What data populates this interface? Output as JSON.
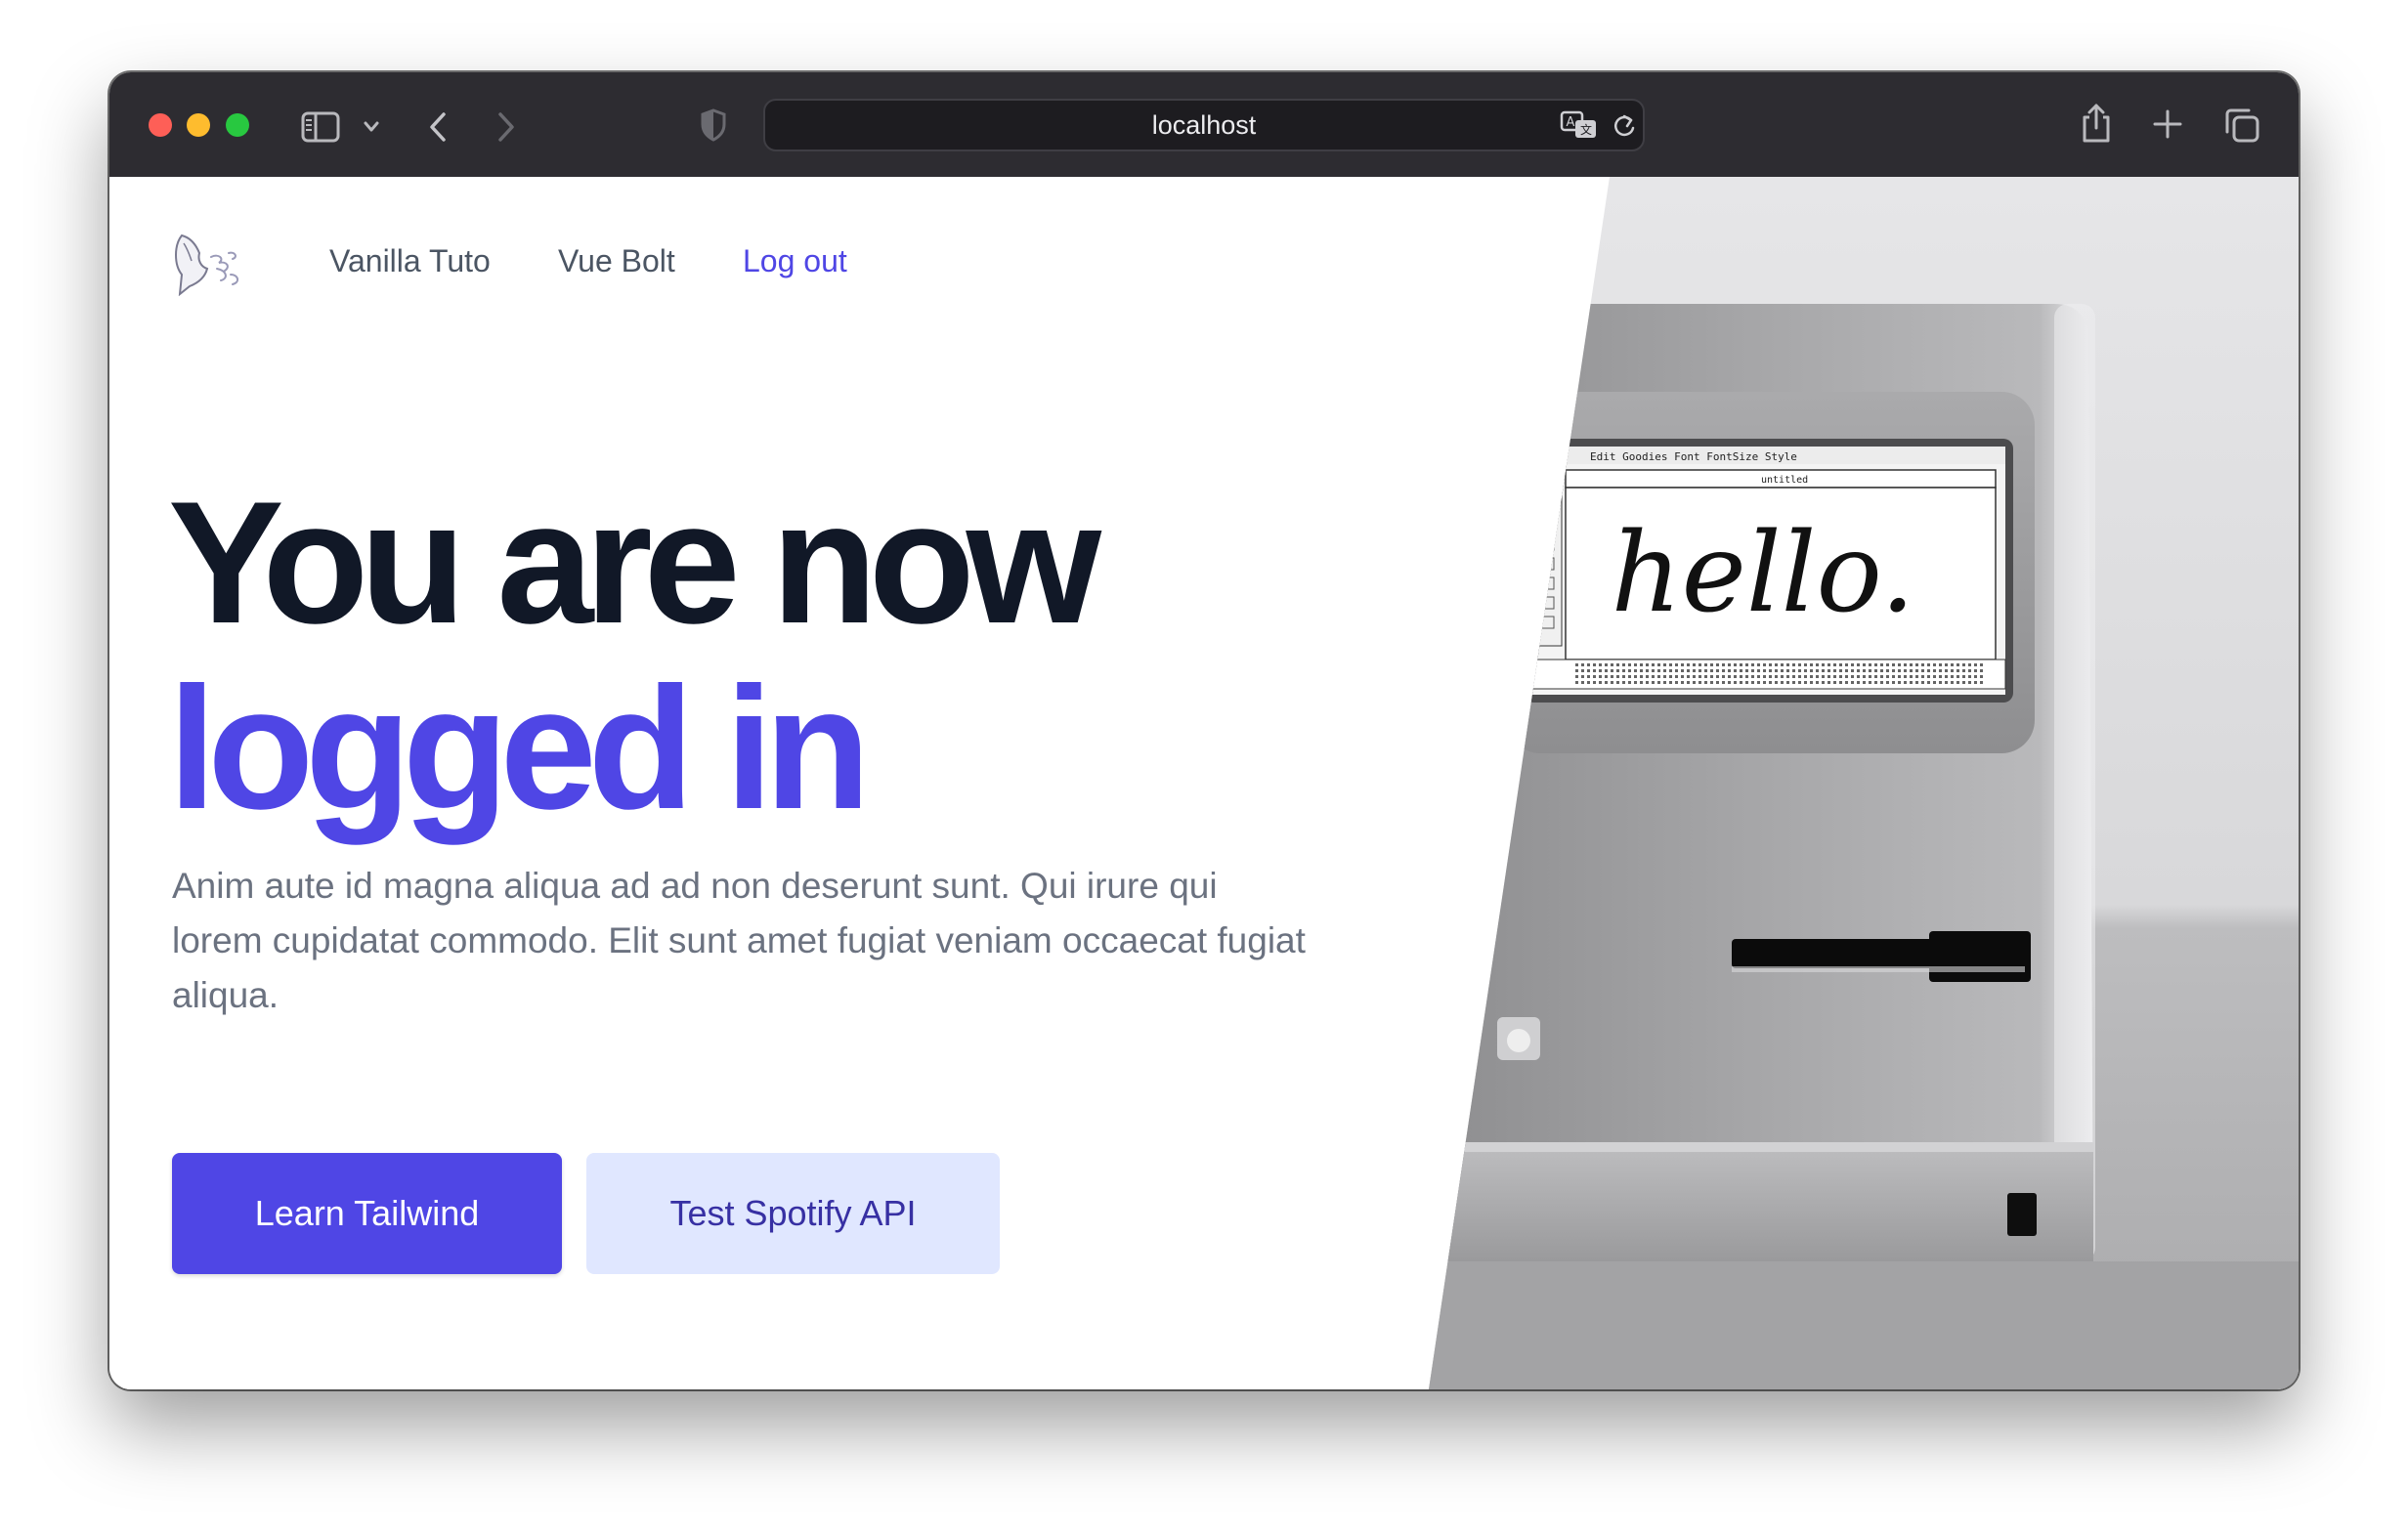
{
  "browser": {
    "url": "localhost",
    "traffic_lights": [
      "close",
      "minimize",
      "zoom"
    ],
    "toolbar_icons": [
      "sidebar-icon",
      "chevron-down-icon",
      "back-icon",
      "forward-icon",
      "shield-icon",
      "translate-icon",
      "reload-icon",
      "share-icon",
      "new-tab-icon",
      "tabs-overview-icon"
    ]
  },
  "nav": {
    "logo": "logo-icon",
    "items": [
      {
        "label": "Vanilla Tuto"
      },
      {
        "label": "Vue Bolt"
      },
      {
        "label": "Log out"
      }
    ]
  },
  "hero": {
    "title_line1": "You are now",
    "title_line2": "logged in",
    "description": "Anim aute id magna aliqua ad ad non deserunt sunt. Qui irure qui lorem cupidatat commodo. Elit sunt amet fugiat veniam occaecat fugiat aliqua.",
    "primary_button": "Learn Tailwind",
    "secondary_button": "Test Spotify API"
  },
  "image": {
    "screen_menu": [
      "Edit",
      "Goodies",
      "Font",
      "FontSize",
      "Style"
    ],
    "window_title": "untitled",
    "screen_text": "hello."
  },
  "colors": {
    "accent": "#4f46e5",
    "accent_light": "#e0e7ff",
    "heading": "#111827",
    "muted": "#6b7280",
    "toolbar": "#2d2c31"
  }
}
